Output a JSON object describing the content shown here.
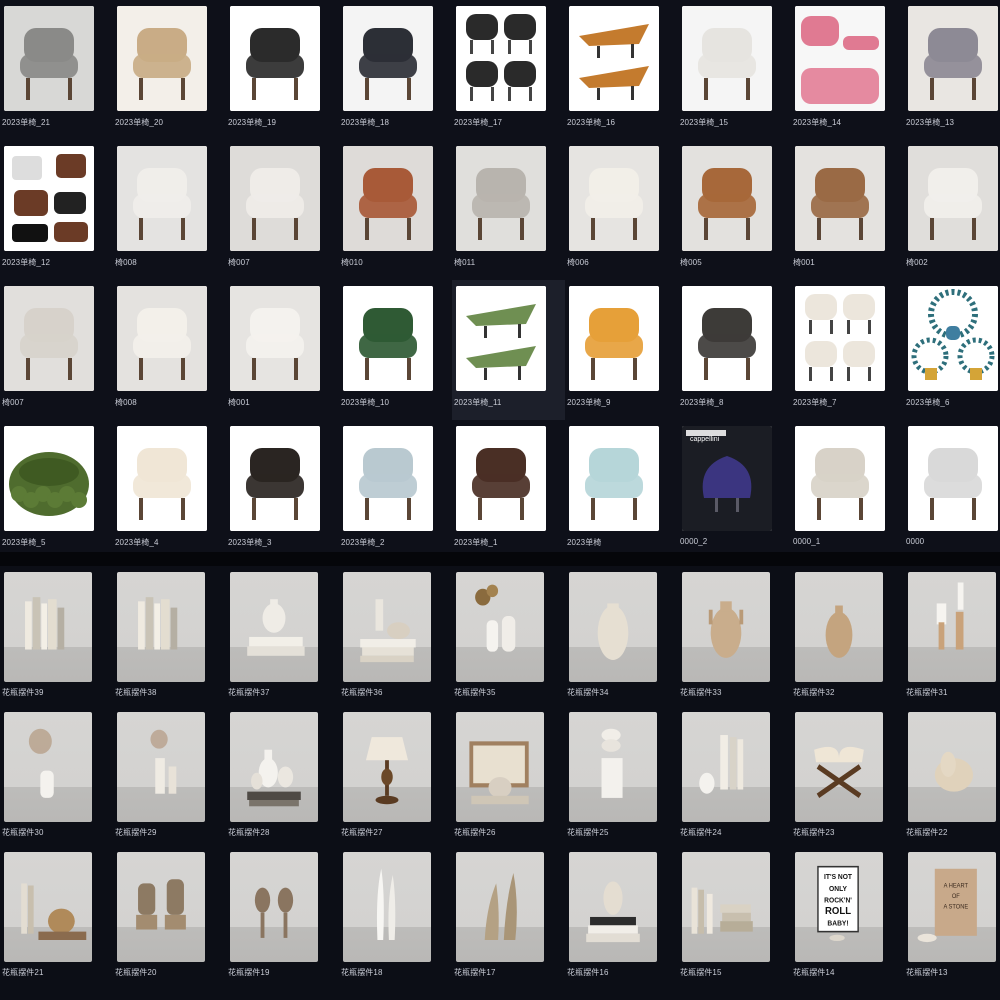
{
  "chairs": [
    {
      "label": "2023单椅_21",
      "icon": "lounge-chair-grey"
    },
    {
      "label": "2023单椅_20",
      "icon": "wooden-armchair-beige"
    },
    {
      "label": "2023单椅_19",
      "icon": "wingback-chair-set-black"
    },
    {
      "label": "2023单椅_18",
      "icon": "dark-tufted-chair"
    },
    {
      "label": "2023单椅_17",
      "icon": "black-shell-chairs-four"
    },
    {
      "label": "2023单椅_16",
      "icon": "orange-sling-chaise-two"
    },
    {
      "label": "2023单椅_15",
      "icon": "white-loop-chair"
    },
    {
      "label": "2023单椅_14",
      "icon": "pink-chair-set"
    },
    {
      "label": "2023单椅_13",
      "icon": "cushioned-sofa-chair"
    },
    {
      "label": "2023单椅_12",
      "icon": "eames-lounge-chair-set"
    },
    {
      "label": "椅008",
      "icon": "white-curved-chair"
    },
    {
      "label": "椅007",
      "icon": "white-folded-chaise"
    },
    {
      "label": "椅010",
      "icon": "brown-leather-sling-chair"
    },
    {
      "label": "椅011",
      "icon": "grey-boxy-armchair"
    },
    {
      "label": "椅006",
      "icon": "white-stacked-cushion-chair"
    },
    {
      "label": "椅005",
      "icon": "tan-cantilever-chair"
    },
    {
      "label": "椅001",
      "icon": "brown-lounge-armchair"
    },
    {
      "label": "椅002",
      "icon": "white-rolled-armchair"
    },
    {
      "label": "椅007",
      "icon": "metal-frame-armchair"
    },
    {
      "label": "椅008",
      "icon": "tufted-white-armchair"
    },
    {
      "label": "椅001",
      "icon": "boucle-egg-chair"
    },
    {
      "label": "2023单椅_10",
      "icon": "green-velvet-chair"
    },
    {
      "label": "2023单椅_11",
      "icon": "green-origami-chairs"
    },
    {
      "label": "2023单椅_9",
      "icon": "orange-shell-dining-chair"
    },
    {
      "label": "2023单椅_8",
      "icon": "dark-box-armchair"
    },
    {
      "label": "2023单椅_7",
      "icon": "boucle-chairs-four"
    },
    {
      "label": "2023单椅_6",
      "icon": "peacock-chairs"
    },
    {
      "label": "2023单椅_5",
      "icon": "green-bubble-chair"
    },
    {
      "label": "2023单椅_4",
      "icon": "wood-cream-armchair"
    },
    {
      "label": "2023单椅_3",
      "icon": "black-leather-wood-chair"
    },
    {
      "label": "2023单椅_2",
      "icon": "acrylic-fur-chair"
    },
    {
      "label": "2023单椅_1",
      "icon": "brown-leather-steel-chair"
    },
    {
      "label": "2023单椅",
      "icon": "glass-lounge-chair"
    },
    {
      "label": "0000_2",
      "icon": "blue-fan-chair"
    },
    {
      "label": "0000_1",
      "icon": "wood-grey-armchair"
    },
    {
      "label": "0000",
      "icon": "grey-bean-chair"
    }
  ],
  "decor": [
    {
      "label": "花瓶摆件39",
      "icon": "books-upright"
    },
    {
      "label": "花瓶摆件38",
      "icon": "books-thin"
    },
    {
      "label": "花瓶摆件37",
      "icon": "vase-on-books"
    },
    {
      "label": "花瓶摆件36",
      "icon": "vases-on-books-stack"
    },
    {
      "label": "花瓶摆件35",
      "icon": "vases-dried-flowers"
    },
    {
      "label": "花瓶摆件34",
      "icon": "ribbed-vase"
    },
    {
      "label": "花瓶摆件33",
      "icon": "amphora-vase"
    },
    {
      "label": "花瓶摆件32",
      "icon": "clay-jug"
    },
    {
      "label": "花瓶摆件31",
      "icon": "candle-holders"
    },
    {
      "label": "花瓶摆件30",
      "icon": "vase-dried-twigs"
    },
    {
      "label": "花瓶摆件29",
      "icon": "tall-vases-twig"
    },
    {
      "label": "花瓶摆件28",
      "icon": "white-vases-books"
    },
    {
      "label": "花瓶摆件27",
      "icon": "table-lamp"
    },
    {
      "label": "花瓶摆件26",
      "icon": "frame-and-bowl"
    },
    {
      "label": "花瓶摆件25",
      "icon": "stacked-bowls-pedestal"
    },
    {
      "label": "花瓶摆件24",
      "icon": "books-and-vase"
    },
    {
      "label": "花瓶摆件23",
      "icon": "open-book-stand"
    },
    {
      "label": "花瓶摆件22",
      "icon": "stone-sculpture"
    },
    {
      "label": "花瓶摆件21",
      "icon": "books-and-pot"
    },
    {
      "label": "花瓶摆件20",
      "icon": "lion-statues"
    },
    {
      "label": "花瓶摆件19",
      "icon": "ornamental-figures"
    },
    {
      "label": "花瓶摆件18",
      "icon": "slim-white-vases"
    },
    {
      "label": "花瓶摆件17",
      "icon": "twisted-cones"
    },
    {
      "label": "花瓶摆件16",
      "icon": "vase-on-book-stack"
    },
    {
      "label": "花瓶摆件15",
      "icon": "books-row"
    },
    {
      "label": "花瓶摆件14",
      "icon": "rock-poster-frame"
    },
    {
      "label": "花瓶摆件13",
      "icon": "book-cover-bowl"
    }
  ],
  "poster_texts": {
    "rock": [
      "IT'S NOT",
      "ONLY",
      "ROCK'N'",
      "ROLL",
      "BABY!"
    ],
    "book": [
      "A HEART",
      "OF",
      "A STONE"
    ],
    "brand": "cappellini"
  },
  "selected_index": 22
}
